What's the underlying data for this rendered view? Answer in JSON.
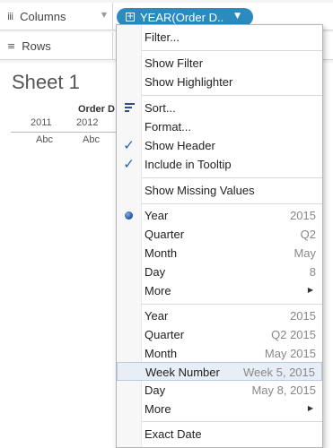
{
  "shelves": {
    "columns_label": "Columns",
    "rows_label": "Rows",
    "columns_icon": "iii",
    "rows_icon": "≡",
    "pill_label": "YEAR(Order D.."
  },
  "sheet": {
    "title": "Sheet 1",
    "field_header": "Order D",
    "years": [
      "2011",
      "2012"
    ],
    "cells": [
      "Abc",
      "Abc"
    ]
  },
  "menu": {
    "filter": "Filter...",
    "show_filter": "Show Filter",
    "show_highlighter": "Show Highlighter",
    "sort": "Sort...",
    "format": "Format...",
    "show_header": "Show Header",
    "include_in_tooltip": "Include in Tooltip",
    "show_missing_values": "Show Missing Values",
    "date_parts": [
      {
        "label": "Year",
        "value": "2015"
      },
      {
        "label": "Quarter",
        "value": "Q2"
      },
      {
        "label": "Month",
        "value": "May"
      },
      {
        "label": "Day",
        "value": "8"
      },
      {
        "label": "More",
        "value": ""
      }
    ],
    "date_values": [
      {
        "label": "Year",
        "value": "2015"
      },
      {
        "label": "Quarter",
        "value": "Q2 2015"
      },
      {
        "label": "Month",
        "value": "May 2015"
      },
      {
        "label": "Week Number",
        "value": "Week 5, 2015"
      },
      {
        "label": "Day",
        "value": "May 8, 2015"
      },
      {
        "label": "More",
        "value": ""
      }
    ],
    "exact_date": "Exact Date"
  },
  "colors": {
    "pill": "#2b8bbf",
    "check": "#1f63b0",
    "highlight": "#e8eef5"
  }
}
